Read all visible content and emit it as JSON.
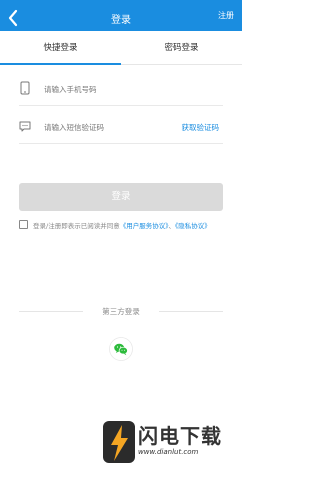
{
  "header": {
    "title": "登录",
    "register": "注册",
    "color": "#1a8de0"
  },
  "tabs": [
    {
      "label": "快捷登录",
      "active": true
    },
    {
      "label": "密码登录",
      "active": false
    }
  ],
  "form": {
    "phone_placeholder": "请输入手机号码",
    "code_placeholder": "请输入短信验证码",
    "get_code": "获取验证码",
    "login_button": "登录"
  },
  "agreement": {
    "checked": false,
    "text": "登录/注册即表示已阅读并同意",
    "link_service": "《用户服务协议》",
    "separator": "、",
    "link_privacy": "《隐私协议》"
  },
  "third_party": {
    "label": "第三方登录",
    "icon": "wechat-icon"
  },
  "watermark": {
    "name": "闪电下载",
    "url": "www.dianlut.com"
  }
}
